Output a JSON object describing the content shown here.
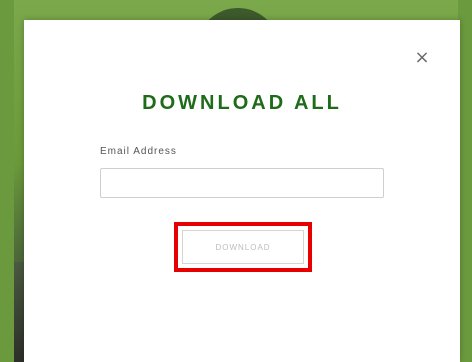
{
  "modal": {
    "close_symbol": "×",
    "title": "DOWNLOAD ALL",
    "email_label": "Email Address",
    "email_value": "",
    "email_placeholder": "",
    "button_label": "DOWNLOAD"
  },
  "colors": {
    "title": "#1e6b1a",
    "highlight": "#e60000",
    "background_green": "#6b9a3e"
  },
  "icons": {
    "close": "close-icon"
  }
}
